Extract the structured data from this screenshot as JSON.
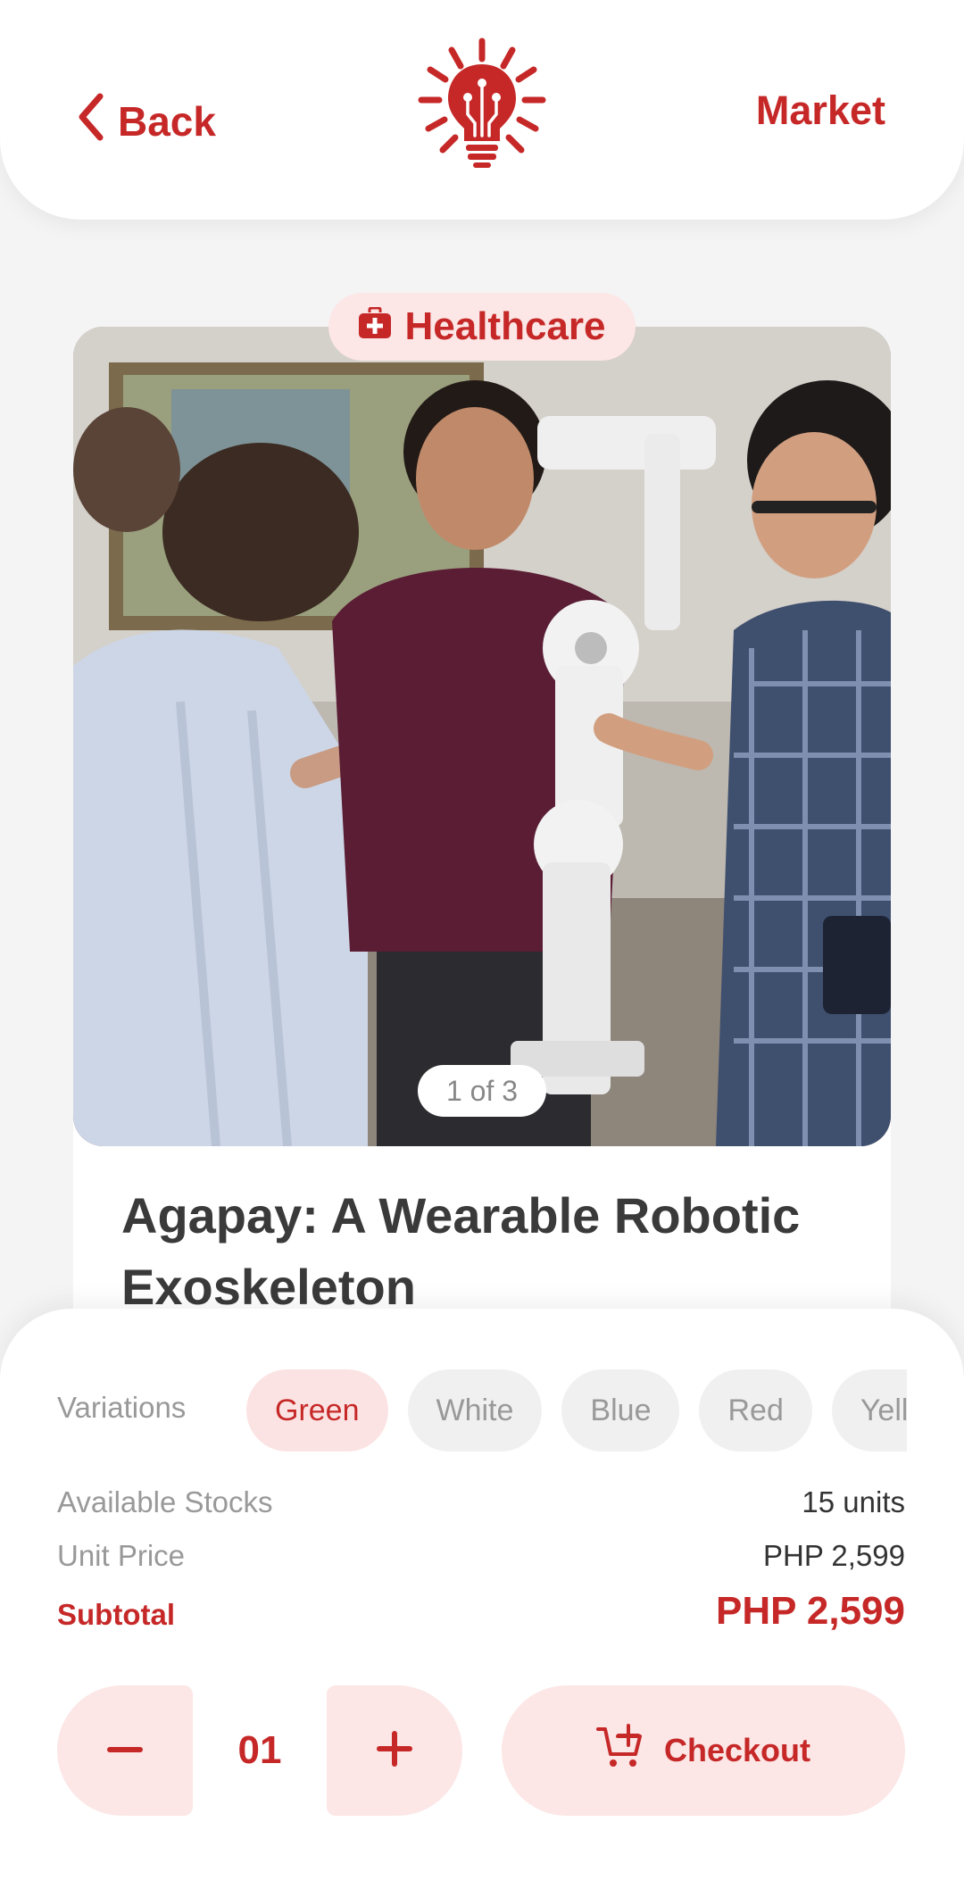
{
  "header": {
    "back_label": "Back",
    "market_label": "Market"
  },
  "product": {
    "category": "Healthcare",
    "image_counter": "1 of 3",
    "title": "Agapay: A Wearable Robotic Exoskeleton"
  },
  "variations": {
    "label": "Variations",
    "options": [
      "Green",
      "White",
      "Blue",
      "Red",
      "Yellow"
    ],
    "selected": "Green"
  },
  "details": {
    "stocks_label": "Available Stocks",
    "stocks_value": "15 units",
    "price_label": "Unit Price",
    "price_value": "PHP 2,599",
    "subtotal_label": "Subtotal",
    "subtotal_value": "PHP 2,599"
  },
  "cart": {
    "quantity": "01",
    "checkout_label": "Checkout"
  },
  "colors": {
    "accent": "#c62828",
    "accent_soft": "#fce6e6",
    "background": "#f4f4f4"
  }
}
